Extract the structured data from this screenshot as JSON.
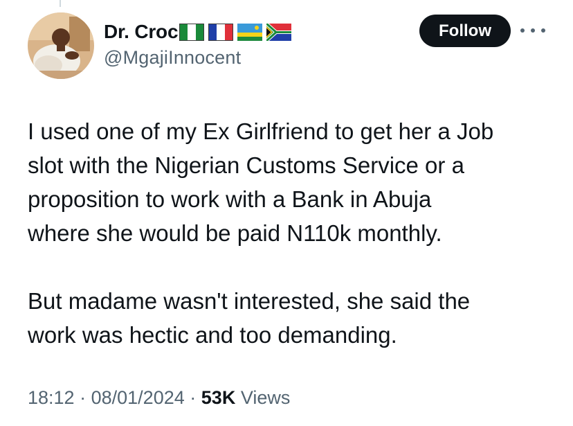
{
  "author": {
    "display_name": "Dr. Croc",
    "handle": "@MgajiInnocent",
    "flags": [
      "nigeria-flag",
      "france-flag",
      "rwanda-flag",
      "south-africa-flag"
    ]
  },
  "actions": {
    "follow_label": "Follow",
    "more_icon": "more-horizontal-icon"
  },
  "tweet": {
    "paragraphs": [
      "I used one of my Ex Girlfriend to get her a Job\nslot with the Nigerian Customs Service or a\nproposition to work with a Bank in Abuja\nwhere she would be paid N110k monthly.",
      "But madame wasn't interested, she said the\nwork was hectic and too demanding."
    ]
  },
  "meta": {
    "time": "18:12",
    "date": "08/01/2024",
    "views_count": "53K",
    "views_label": "Views",
    "separator": "·"
  },
  "colors": {
    "text": "#0f1419",
    "secondary": "#536471",
    "follow_bg": "#0f1419",
    "follow_text": "#ffffff"
  }
}
